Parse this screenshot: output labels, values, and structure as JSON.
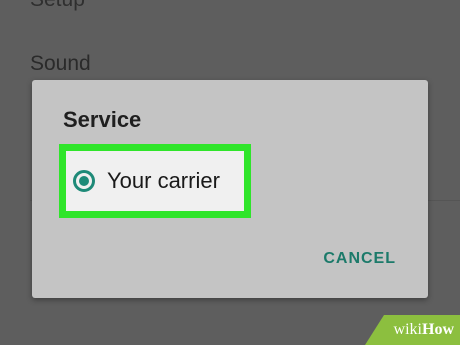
{
  "background": {
    "items": [
      {
        "label": "Setup"
      },
      {
        "label": "Sound"
      }
    ]
  },
  "dialog": {
    "title": "Service",
    "option": {
      "label": "Your carrier",
      "selected": true
    },
    "cancel_label": "CANCEL"
  },
  "watermark": {
    "wiki": "wiki",
    "how": "How"
  },
  "colors": {
    "accent": "#1e8a78",
    "highlight": "#2fe52a",
    "dialog_bg": "#c4c4c4",
    "overlay_bg": "#5e5e5e"
  }
}
